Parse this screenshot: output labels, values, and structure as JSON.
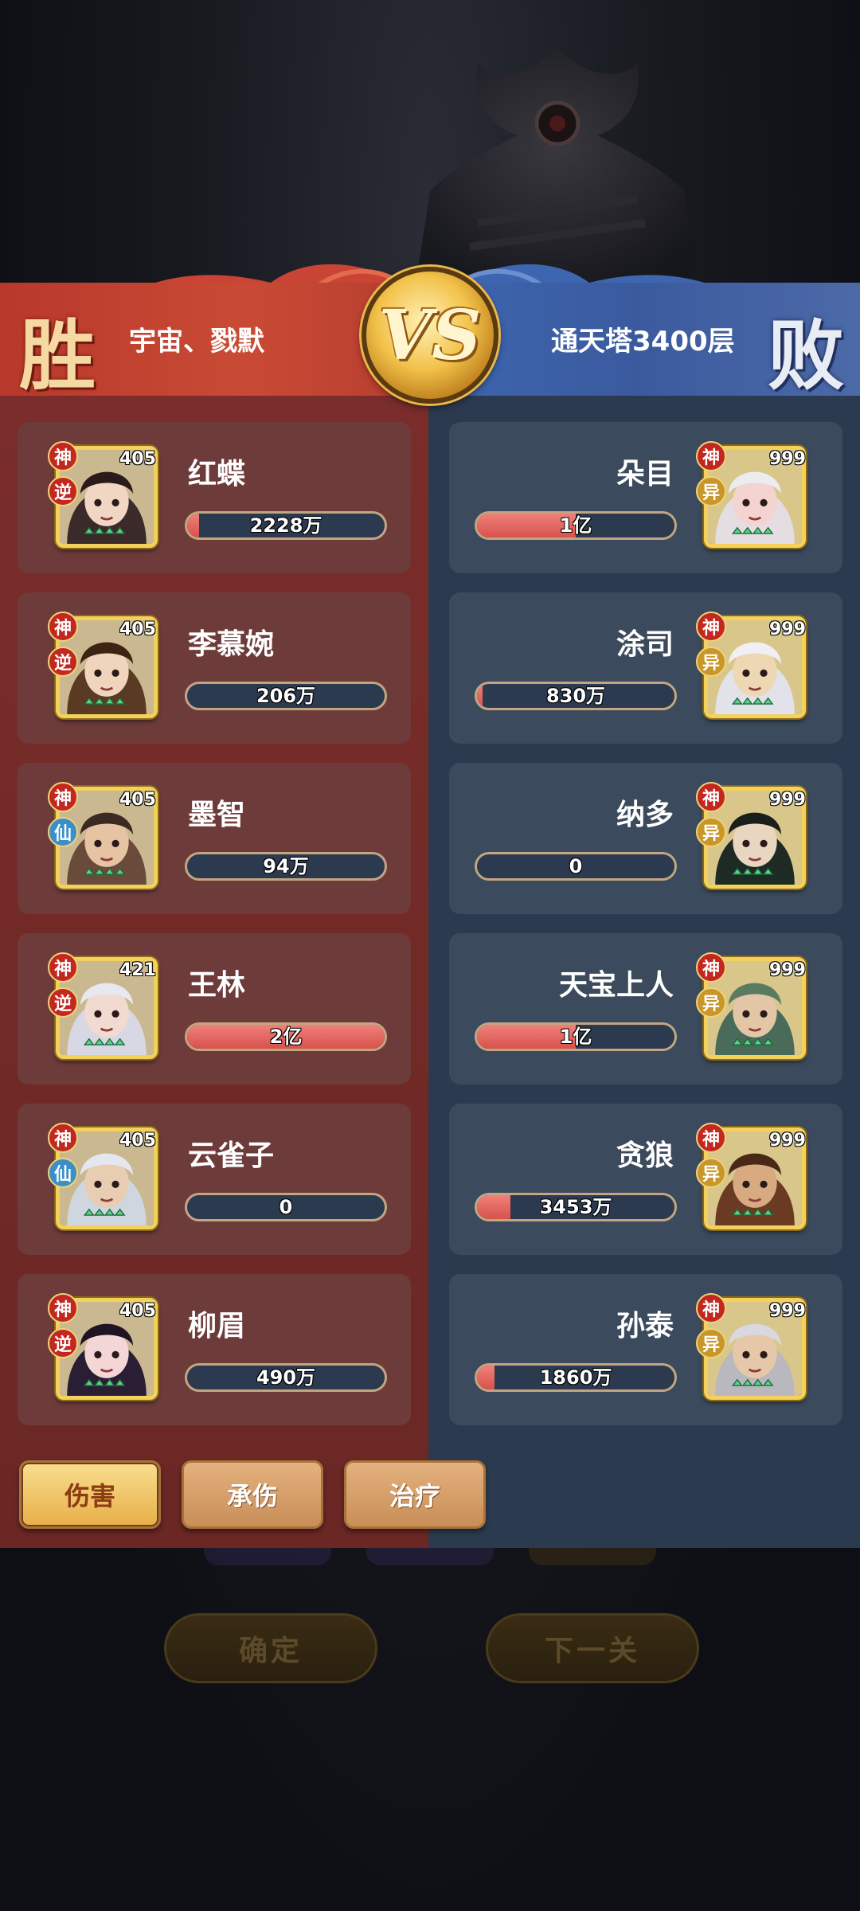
{
  "banner": {
    "win_label": "胜",
    "lose_label": "败",
    "left_team": "宇宙、戮默",
    "right_team": "通天塔3400层",
    "vs_label": "VS"
  },
  "left_heroes": [
    {
      "name": "红蝶",
      "level": "405",
      "badge_top": "神",
      "badge_sub": "逆",
      "damage": "2228万",
      "fill_pct": 6
    },
    {
      "name": "李慕婉",
      "level": "405",
      "badge_top": "神",
      "badge_sub": "逆",
      "damage": "206万",
      "fill_pct": 0
    },
    {
      "name": "墨智",
      "level": "405",
      "badge_top": "神",
      "badge_sub": "仙",
      "damage": "94万",
      "fill_pct": 0
    },
    {
      "name": "王林",
      "level": "421",
      "badge_top": "神",
      "badge_sub": "逆",
      "damage": "2亿",
      "fill_pct": 100
    },
    {
      "name": "云雀子",
      "level": "405",
      "badge_top": "神",
      "badge_sub": "仙",
      "damage": "0",
      "fill_pct": 0
    },
    {
      "name": "柳眉",
      "level": "405",
      "badge_top": "神",
      "badge_sub": "逆",
      "damage": "490万",
      "fill_pct": 0
    }
  ],
  "right_heroes": [
    {
      "name": "朵目",
      "level": "999",
      "badge_top": "神",
      "badge_sub": "异",
      "damage": "1亿",
      "fill_pct": 50
    },
    {
      "name": "涂司",
      "level": "999",
      "badge_top": "神",
      "badge_sub": "异",
      "damage": "830万",
      "fill_pct": 3
    },
    {
      "name": "纳多",
      "level": "999",
      "badge_top": "神",
      "badge_sub": "异",
      "damage": "0",
      "fill_pct": 0
    },
    {
      "name": "天宝上人",
      "level": "999",
      "badge_top": "神",
      "badge_sub": "异",
      "damage": "1亿",
      "fill_pct": 50
    },
    {
      "name": "贪狼",
      "level": "999",
      "badge_top": "神",
      "badge_sub": "异",
      "damage": "3453万",
      "fill_pct": 17
    },
    {
      "name": "孙泰",
      "level": "999",
      "badge_top": "神",
      "badge_sub": "异",
      "damage": "1860万",
      "fill_pct": 9
    }
  ],
  "tabs": [
    {
      "label": "伤害",
      "active": true
    },
    {
      "label": "承伤",
      "active": false
    },
    {
      "label": "治疗",
      "active": false
    }
  ],
  "background_buttons": {
    "confirm": "确定",
    "next_level": "下一关"
  },
  "colors": {
    "win_panel": "#7a2d2a",
    "lose_panel": "#2c3a4f",
    "bar_fill": "#e0615a",
    "portrait_border": "#f3d15a"
  }
}
